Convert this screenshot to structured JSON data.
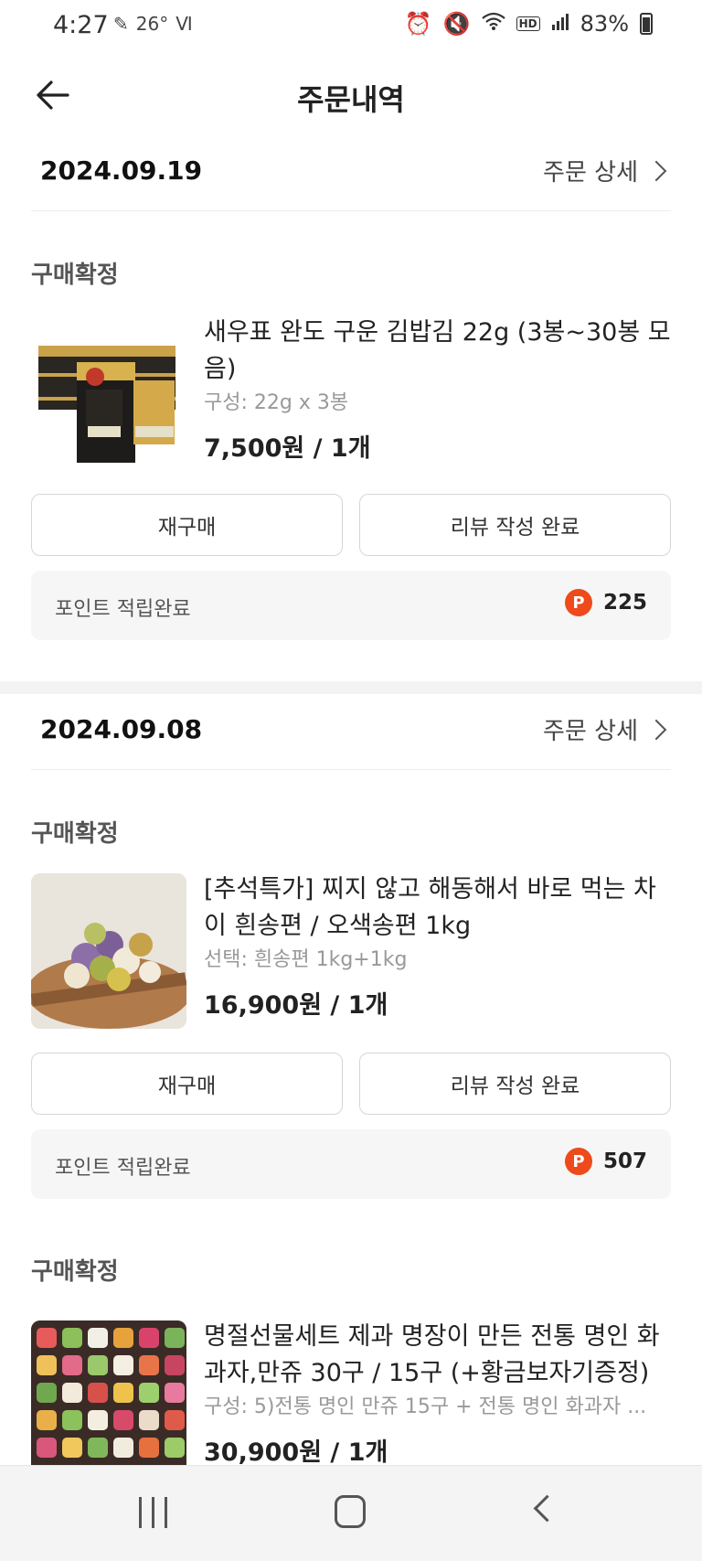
{
  "status_bar": {
    "time": "4:27",
    "temperature": "26°",
    "battery": "83%",
    "hd_label": "HD"
  },
  "header": {
    "title": "주문내역"
  },
  "orders": [
    {
      "date": "2024.09.19",
      "detail_label": "주문 상세",
      "status": "구매확정",
      "product": {
        "title": "새우표 완도 구운 김밥김 22g (3봉~30봉 모음)",
        "option": "구성: 22g x 3봉",
        "price": "7,500원 / 1개"
      },
      "rebuy_label": "재구매",
      "review_label": "리뷰 작성 완료",
      "points_label": "포인트 적립완료",
      "points_value": "225"
    },
    {
      "date": "2024.09.08",
      "detail_label": "주문 상세",
      "status": "구매확정",
      "product": {
        "title": "[추석특가] 찌지 않고 해동해서 바로 먹는 차이 흰송편 / 오색송편 1kg",
        "option": "선택: 흰송편 1kg+1kg",
        "price": "16,900원 / 1개"
      },
      "rebuy_label": "재구매",
      "review_label": "리뷰 작성 완료",
      "points_label": "포인트 적립완료",
      "points_value": "507"
    },
    {
      "status": "구매확정",
      "product": {
        "title": "명절선물세트 제과 명장이 만든 전통 명인 화과자,만쥬 30구 / 15구 (+황금보자기증정)",
        "option": "구성: 5)전통 명인 만쥬 15구 + 전통 명인 화과자 ...",
        "price": "30,900원 / 1개"
      }
    }
  ],
  "point_icon_letter": "P",
  "colors": {
    "point_orange": "#ee4a1c",
    "background": "#ffffff",
    "band": "#f3f3f3"
  }
}
